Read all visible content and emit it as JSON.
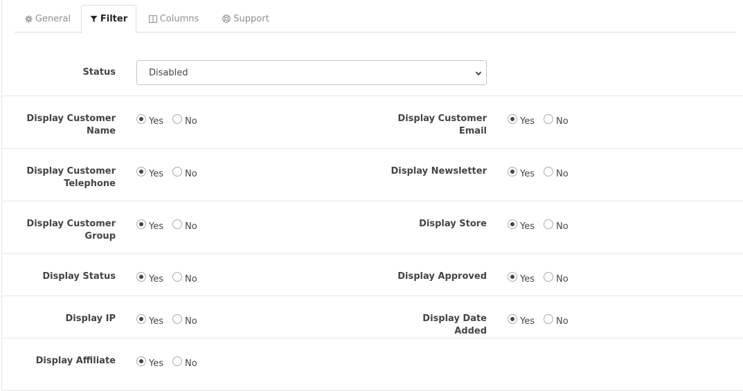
{
  "tabs": [
    {
      "label": "General",
      "icon": "gear-icon"
    },
    {
      "label": "Filter",
      "icon": "filter-icon",
      "active": true
    },
    {
      "label": "Columns",
      "icon": "columns-icon"
    },
    {
      "label": "Support",
      "icon": "lifebuoy-icon"
    }
  ],
  "status": {
    "label": "Status",
    "value": "Disabled"
  },
  "options": {
    "yes": "Yes",
    "no": "No"
  },
  "fields": {
    "customer_name": {
      "label_line1": "Display Customer",
      "label_line2": "Name",
      "value": "Yes"
    },
    "customer_email": {
      "label_line1": "Display Customer",
      "label_line2": "Email",
      "value": "Yes"
    },
    "customer_telephone": {
      "label_line1": "Display Customer",
      "label_line2": "Telephone",
      "value": "Yes"
    },
    "newsletter": {
      "label": "Display Newsletter",
      "value": "Yes"
    },
    "customer_group": {
      "label_line1": "Display Customer",
      "label_line2": "Group",
      "value": "Yes"
    },
    "store": {
      "label": "Display Store",
      "value": "Yes"
    },
    "status": {
      "label": "Display Status",
      "value": "Yes"
    },
    "approved": {
      "label": "Display Approved",
      "value": "Yes"
    },
    "ip": {
      "label": "Display IP",
      "value": "Yes"
    },
    "date_added": {
      "label": "Display Date Added",
      "value": "Yes"
    },
    "affiliate": {
      "label": "Display Affiliate",
      "value": "Yes"
    }
  }
}
